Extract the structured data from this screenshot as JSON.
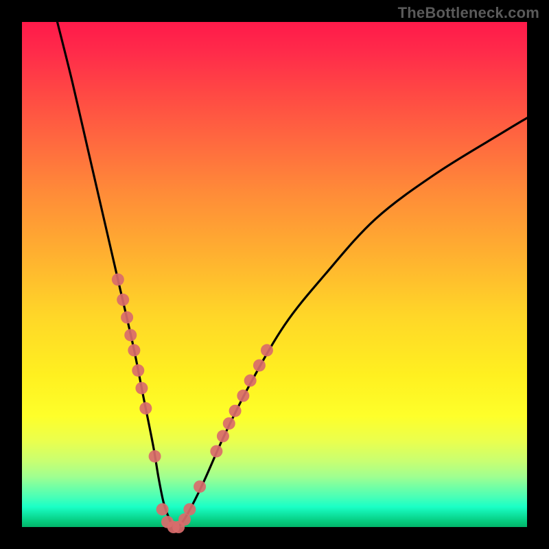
{
  "watermark": {
    "text": "TheBottleneck.com"
  },
  "chart_data": {
    "type": "line",
    "title": "",
    "xlabel": "",
    "ylabel": "",
    "xlim": [
      0,
      100
    ],
    "ylim": [
      0,
      100
    ],
    "series": [
      {
        "name": "bottleneck-curve",
        "x": [
          7,
          10,
          13,
          16,
          19,
          22,
          24,
          26,
          27,
          28,
          29,
          30,
          31,
          33,
          36,
          40,
          45,
          52,
          60,
          70,
          82,
          95,
          100
        ],
        "values": [
          100,
          88,
          75,
          62,
          49,
          36,
          26,
          16,
          10,
          5,
          2,
          0,
          0,
          3,
          9,
          18,
          28,
          40,
          50,
          61,
          70,
          78,
          81
        ]
      }
    ],
    "markers": {
      "name": "highlight-dots",
      "color": "#d96b6b",
      "radius_px": 9,
      "points": [
        {
          "x": 19.0,
          "y": 49.0
        },
        {
          "x": 20.0,
          "y": 45.0
        },
        {
          "x": 20.8,
          "y": 41.5
        },
        {
          "x": 21.5,
          "y": 38.0
        },
        {
          "x": 22.2,
          "y": 35.0
        },
        {
          "x": 23.0,
          "y": 31.0
        },
        {
          "x": 23.7,
          "y": 27.5
        },
        {
          "x": 24.5,
          "y": 23.5
        },
        {
          "x": 26.3,
          "y": 14.0
        },
        {
          "x": 27.8,
          "y": 3.5
        },
        {
          "x": 28.8,
          "y": 1.0
        },
        {
          "x": 30.0,
          "y": 0.0
        },
        {
          "x": 31.0,
          "y": 0.0
        },
        {
          "x": 32.2,
          "y": 1.5
        },
        {
          "x": 33.2,
          "y": 3.5
        },
        {
          "x": 35.2,
          "y": 8.0
        },
        {
          "x": 38.5,
          "y": 15.0
        },
        {
          "x": 39.8,
          "y": 18.0
        },
        {
          "x": 41.0,
          "y": 20.5
        },
        {
          "x": 42.2,
          "y": 23.0
        },
        {
          "x": 43.8,
          "y": 26.0
        },
        {
          "x": 45.2,
          "y": 29.0
        },
        {
          "x": 47.0,
          "y": 32.0
        },
        {
          "x": 48.5,
          "y": 35.0
        }
      ]
    }
  }
}
